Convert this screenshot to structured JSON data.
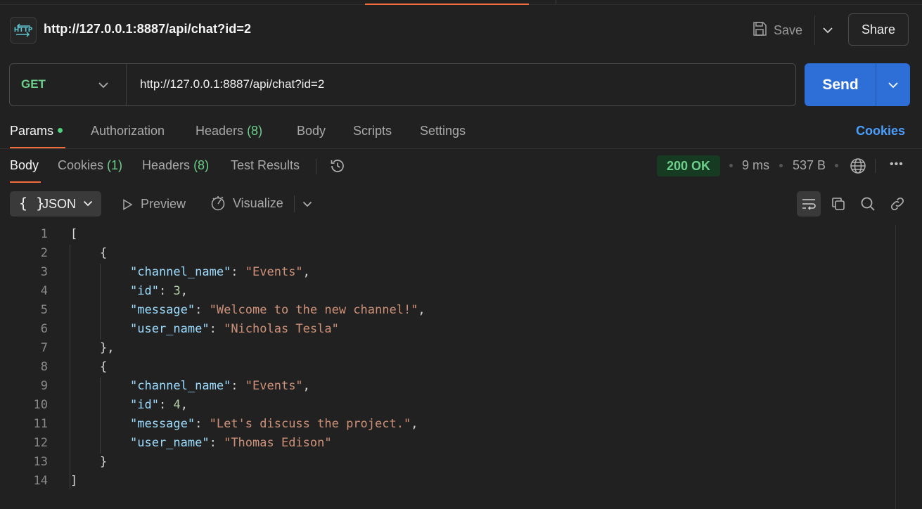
{
  "header": {
    "title": "http://127.0.0.1:8887/api/chat?id=2",
    "save_label": "Save",
    "share_label": "Share"
  },
  "request": {
    "method": "GET",
    "url": "http://127.0.0.1:8887/api/chat?id=2",
    "send_label": "Send"
  },
  "request_tabs": {
    "params": "Params",
    "authorization": "Authorization",
    "headers": "Headers",
    "headers_count": "(8)",
    "body": "Body",
    "scripts": "Scripts",
    "settings": "Settings",
    "cookies_link": "Cookies"
  },
  "response_tabs": {
    "body": "Body",
    "cookies": "Cookies",
    "cookies_count": "(1)",
    "headers": "Headers",
    "headers_count": "(8)",
    "test_results": "Test Results"
  },
  "response_meta": {
    "status": "200 OK",
    "time": "9 ms",
    "size": "537 B",
    "more": "ooo"
  },
  "format_bar": {
    "format": "JSON",
    "braces": "{ }",
    "preview": "Preview",
    "visualize": "Visualize"
  },
  "code_lines": [
    {
      "n": "1",
      "text": "["
    },
    {
      "n": "2",
      "text": "{"
    },
    {
      "n": "3",
      "key": "\"channel_name\"",
      "value": "\"Events\"",
      "trail": ","
    },
    {
      "n": "4",
      "key": "\"id\"",
      "value": "3",
      "trail": ","
    },
    {
      "n": "5",
      "key": "\"message\"",
      "value": "\"Welcome to the new channel!\"",
      "trail": ","
    },
    {
      "n": "6",
      "key": "\"user_name\"",
      "value": "\"Nicholas Tesla\"",
      "trail": ""
    },
    {
      "n": "7",
      "text": "},"
    },
    {
      "n": "8",
      "text": "{"
    },
    {
      "n": "9",
      "key": "\"channel_name\"",
      "value": "\"Events\"",
      "trail": ","
    },
    {
      "n": "10",
      "key": "\"id\"",
      "value": "4",
      "trail": ","
    },
    {
      "n": "11",
      "key": "\"message\"",
      "value": "\"Let's discuss the project.\"",
      "trail": ","
    },
    {
      "n": "12",
      "key": "\"user_name\"",
      "value": "\"Thomas Edison\"",
      "trail": ""
    },
    {
      "n": "13",
      "text": "}"
    },
    {
      "n": "14",
      "text": "]"
    }
  ]
}
